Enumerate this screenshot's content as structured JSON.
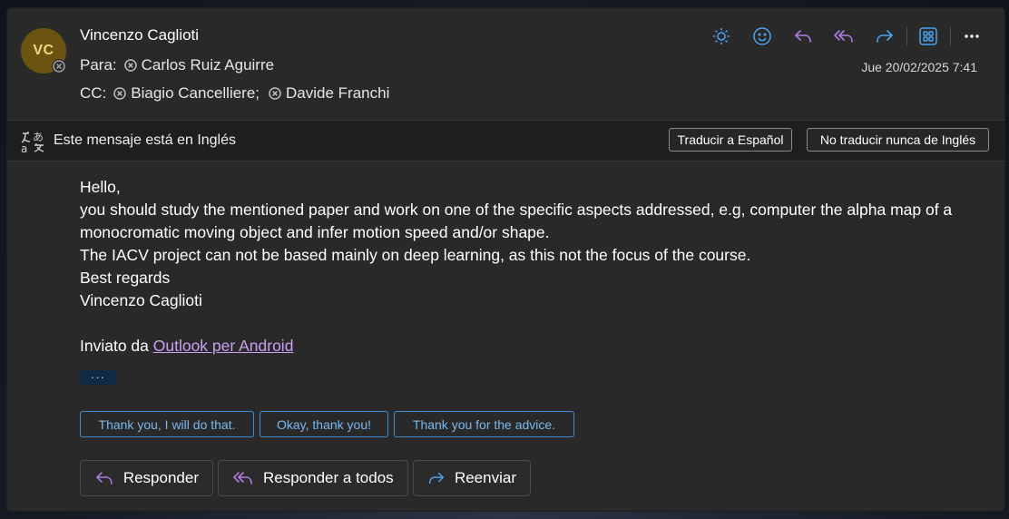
{
  "header": {
    "avatar_initials": "VC",
    "sender": "Vincenzo Caglioti",
    "to_label": "Para:",
    "to": [
      "Carlos Ruiz Aguirre"
    ],
    "cc_label": "CC:",
    "cc": [
      "Biagio Cancelliere;",
      "Davide Franchi"
    ],
    "date": "Jue 20/02/2025 7:41",
    "toolbar_icons": [
      "sun-icon",
      "smiley-icon",
      "reply-icon",
      "reply-all-icon",
      "forward-icon",
      "apps-icon",
      "more-icon"
    ]
  },
  "translate": {
    "message": "Este mensaje está en Inglés",
    "translate_button": "Traducir a Español",
    "never_button": "No traducir nunca de Inglés"
  },
  "body": {
    "greeting": "Hello,",
    "line1": "you should study the mentioned paper and work on one of the specific aspects addressed, e.g, computer the alpha map of a monocromatic moving object and infer motion speed and/or shape.",
    "line2": "The IACV project can not be based mainly on deep learning, as this not the focus of the course.",
    "closing": "Best regards",
    "signer": "Vincenzo Caglioti",
    "sent_from_prefix": "Inviato da ",
    "sent_from_link": "Outlook per Android",
    "ellipsis": "···"
  },
  "suggested_replies": [
    "Thank you, I will do that.",
    "Okay, thank you!",
    "Thank you for the advice."
  ],
  "actions": {
    "reply": "Responder",
    "reply_all": "Responder a todos",
    "forward": "Reenviar"
  },
  "colors": {
    "accent_blue": "#3b8ed6",
    "reply_purple": "#b07be0",
    "link": "#c9a0f0",
    "avatar_bg": "#6b5410"
  }
}
